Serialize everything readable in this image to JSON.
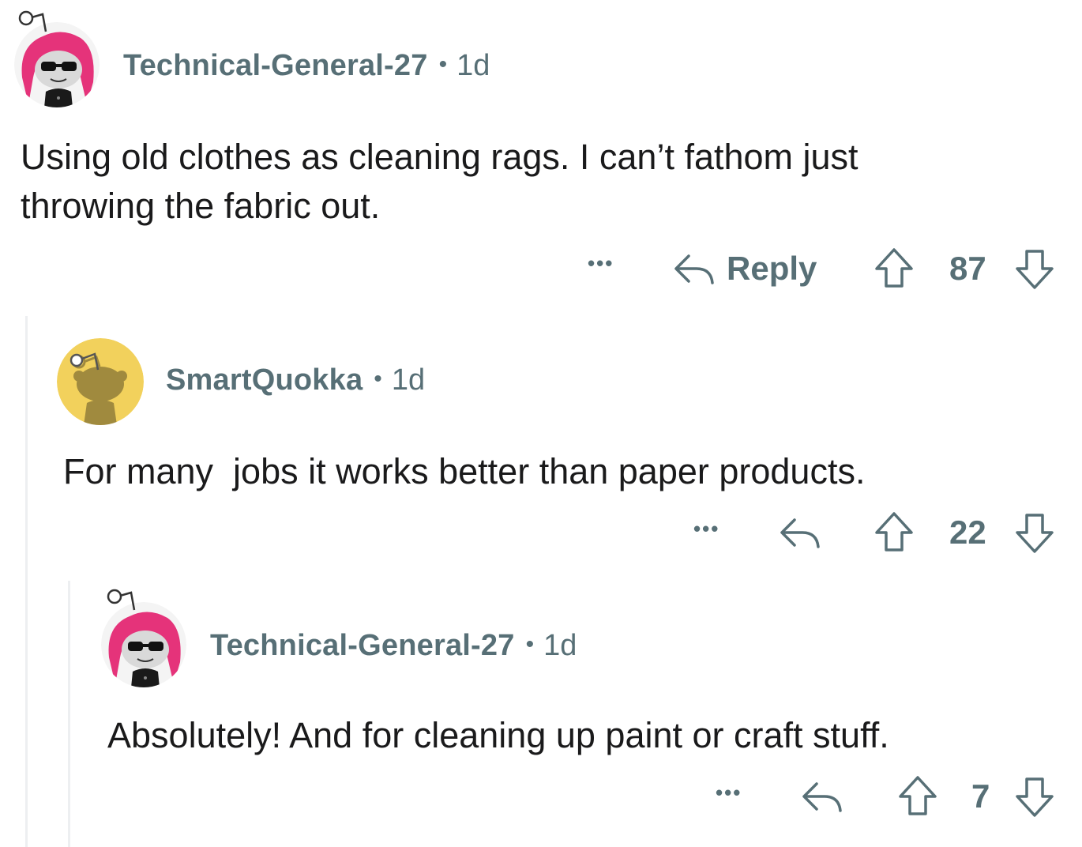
{
  "comments": [
    {
      "username": "Technical-General-27",
      "separator": "•",
      "age": "1d",
      "text_lines": [
        "Using old clothes as cleaning rags. I can’t fathom just",
        "throwing the fabric out."
      ],
      "more_label": "•••",
      "reply_label": "Reply",
      "score": "87",
      "avatar": "pink-hair-sunglasses-snoo"
    },
    {
      "username": "SmartQuokka",
      "separator": "•",
      "age": "1d",
      "text_lines": [
        "For many  jobs it works better than paper products."
      ],
      "more_label": "•••",
      "score": "22",
      "avatar": "default-yellow-snoo"
    },
    {
      "username": "Technical-General-27",
      "separator": "•",
      "age": "1d",
      "text_lines": [
        "Absolutely! And for cleaning up paint or craft stuff."
      ],
      "more_label": "•••",
      "score": "7",
      "avatar": "pink-hair-sunglasses-snoo"
    }
  ],
  "colors": {
    "meta_text": "#576f76",
    "body_text": "#1a1a1b",
    "thread_line": "#edeff1",
    "avatar_pink": "#e5337a",
    "avatar_yellow": "#f2d15c"
  },
  "icons": [
    "reply-icon",
    "upvote-icon",
    "downvote-icon",
    "more-options-icon"
  ]
}
